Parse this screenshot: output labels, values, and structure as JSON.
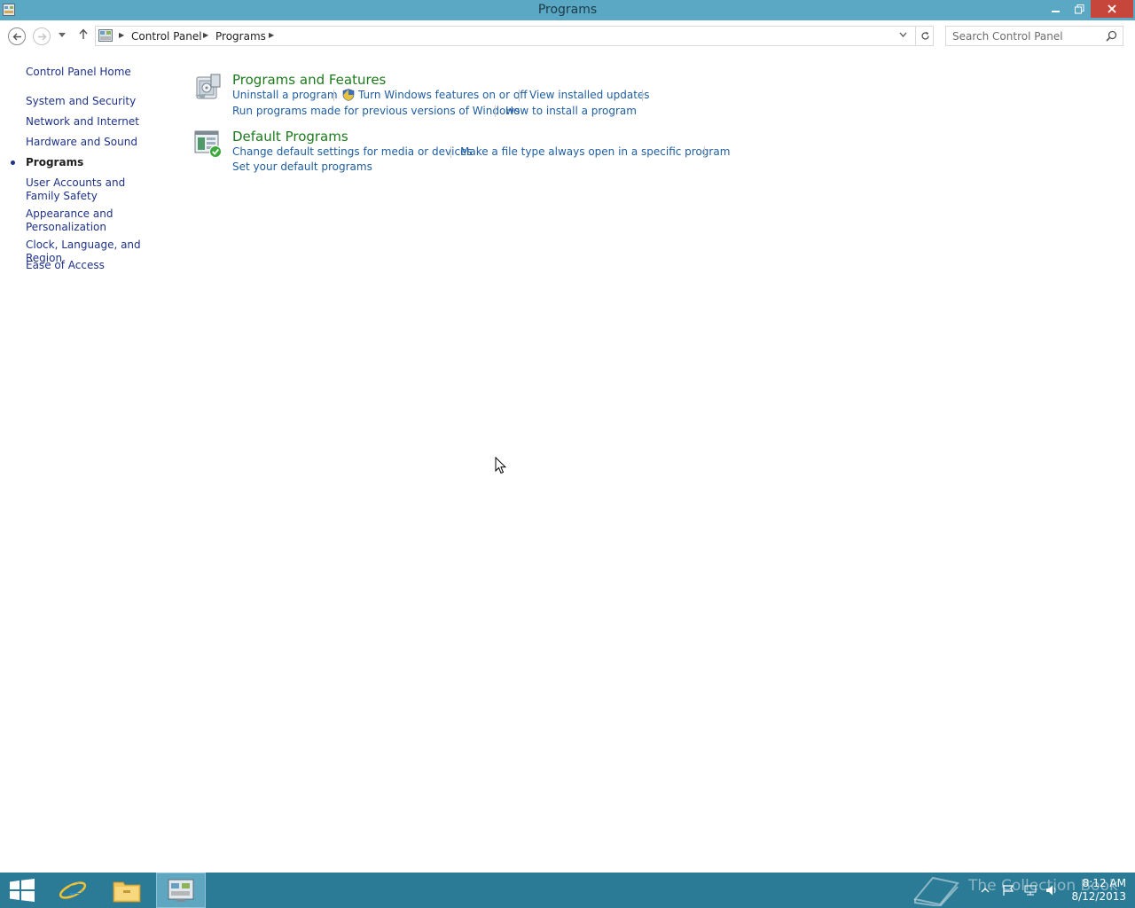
{
  "window": {
    "title": "Programs"
  },
  "address_bar": {
    "crumbs": [
      "Control Panel",
      "Programs"
    ]
  },
  "search": {
    "placeholder": "Search Control Panel"
  },
  "left_nav": {
    "home": "Control Panel Home",
    "items": [
      "System and Security",
      "Network and Internet",
      "Hardware and Sound",
      "Programs",
      "User Accounts and Family Safety",
      "Appearance and Personalization",
      "Clock, Language, and Region",
      "Ease of Access"
    ],
    "active_item": "Programs"
  },
  "categories": [
    {
      "title": "Programs and Features",
      "icon": "programs-and-features-icon",
      "links": [
        "Uninstall a program",
        "Turn Windows features on or off",
        "View installed updates",
        "Run programs made for previous versions of Windows",
        "How to install a program"
      ]
    },
    {
      "title": "Default Programs",
      "icon": "default-programs-icon",
      "links": [
        "Change default settings for media or devices",
        "Make a file type always open in a specific program",
        "Set your default programs"
      ]
    }
  ],
  "taskbar": {
    "apps": [
      "start-icon",
      "internet-explorer-icon",
      "file-explorer-icon",
      "control-panel-icon"
    ],
    "watermark": "The Collection Book",
    "clock_time": "8:12 AM",
    "clock_date": "8/12/2013"
  },
  "colors": {
    "titlebar": "#5ba8c4",
    "taskbar": "#2b7a96",
    "category_title": "#1d7a1d",
    "link": "#1e5d9f",
    "close_button": "#c7463b"
  }
}
